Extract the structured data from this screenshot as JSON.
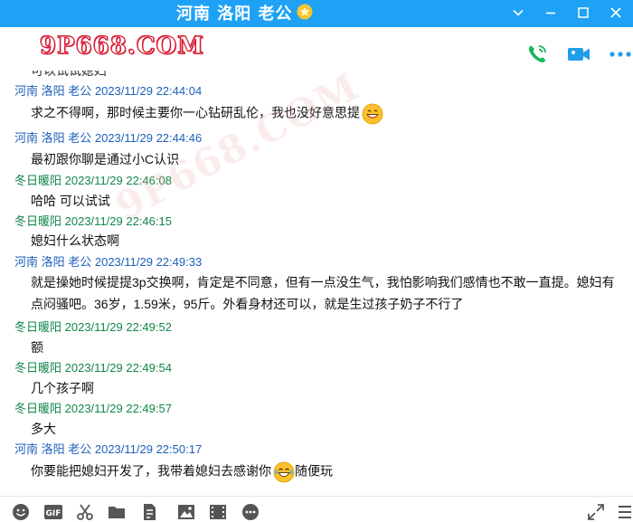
{
  "window": {
    "title": "河南 洛阳 老公"
  },
  "logo_text": "9P668.COM",
  "watermark_text": "9P668.COM",
  "messages": [
    {
      "sender": "",
      "time": "",
      "text": "可以试试媳妇",
      "color": "blue"
    },
    {
      "sender": "河南 洛阳 老公",
      "time": "2023/11/29 22:44:04",
      "text": "求之不得啊，那时候主要你一心钻研乱伦，我也没好意思提",
      "emoji": "grin-emoji"
    },
    {
      "sender": "河南 洛阳 老公",
      "time": "2023/11/29 22:44:46",
      "text": "最初跟你聊是通过小C认识"
    },
    {
      "sender": "冬日暖阳",
      "time": "2023/11/29 22:46:08",
      "text": "哈哈  可以试试"
    },
    {
      "sender": "冬日暖阳",
      "time": "2023/11/29 22:46:15",
      "text": "媳妇什么状态啊"
    },
    {
      "sender": "河南 洛阳 老公",
      "time": "2023/11/29 22:49:33",
      "text": "就是操她时候提提3p交换啊，肯定是不同意，但有一点没生气，我怕影响我们感情也不敢一直提。媳妇有",
      "text2": "点闷骚吧。36岁，1.59米，95斤。外看身材还可以，就是生过孩子奶子不行了"
    },
    {
      "sender": "冬日暖阳",
      "time": "2023/11/29 22:49:52",
      "text": "额"
    },
    {
      "sender": "冬日暖阳",
      "time": "2023/11/29 22:49:54",
      "text": "几个孩子啊"
    },
    {
      "sender": "冬日暖阳",
      "time": "2023/11/29 22:49:57",
      "text": "多大"
    },
    {
      "sender": "河南 洛阳 老公",
      "time": "2023/11/29 22:50:17",
      "text": "你要能把媳妇开发了，我带着媳妇去感谢你",
      "emoji": "laugh-cry-emoji",
      "text_after": "随便玩"
    }
  ],
  "colors": {
    "titlebar": "#1fa2f5",
    "sender_blue": "#1d5fbb",
    "sender_green": "#11864a",
    "phone_green": "#1bb55c",
    "video_blue": "#1f9fe8"
  },
  "toolbar_icons": [
    "emoji-icon",
    "gif-icon",
    "scissors-icon",
    "folder-icon",
    "doc-icon",
    "image-icon",
    "video-file-icon",
    "more-icon",
    "expand-icon",
    "menu-icon"
  ]
}
